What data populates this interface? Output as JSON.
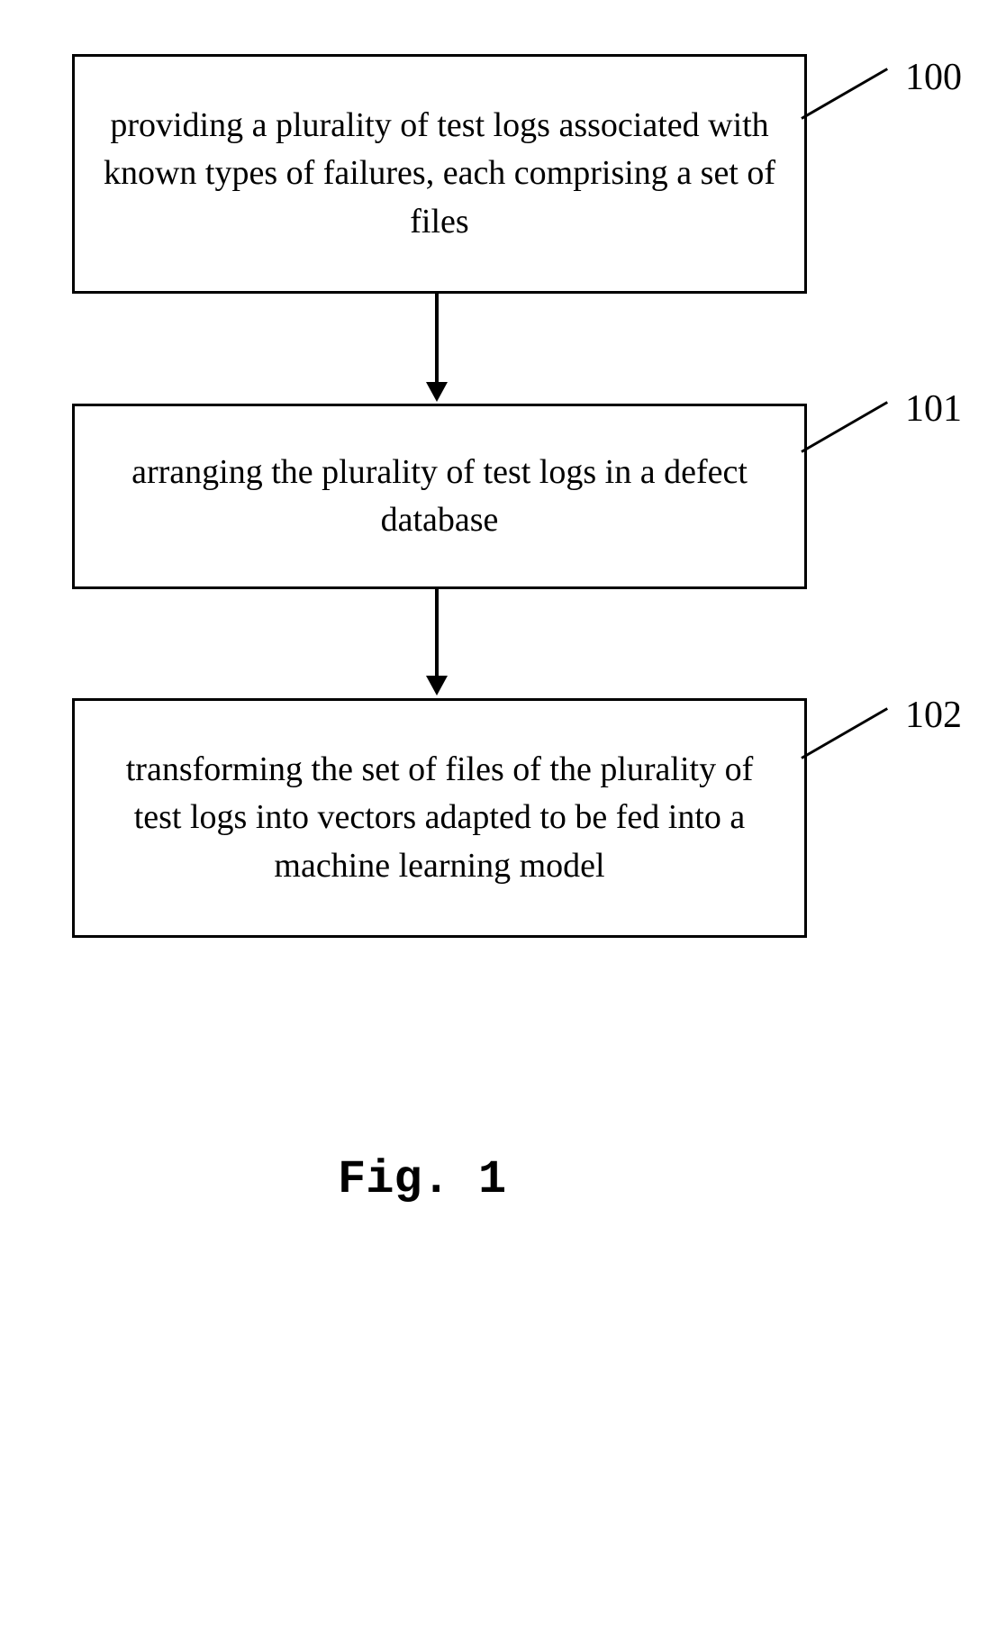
{
  "steps": [
    {
      "label": "100",
      "text": "providing a plurality of test logs associated with known types of failures, each comprising a set of files"
    },
    {
      "label": "101",
      "text": "arranging the plurality of test logs in a defect database"
    },
    {
      "label": "102",
      "text": "transforming the set of files of the plurality of test logs into vectors adapted to be fed into a machine learning model"
    }
  ],
  "caption": "Fig. 1"
}
